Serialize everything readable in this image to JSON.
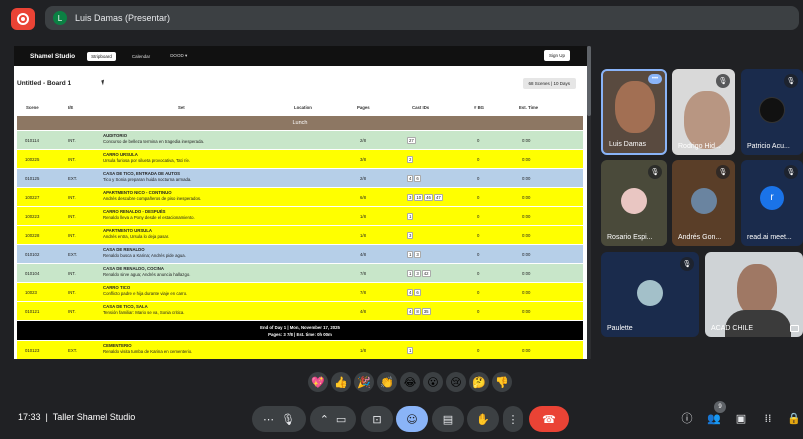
{
  "presenter": {
    "avatar_letter": "L",
    "label": "Luis Damas (Presentar)"
  },
  "app": {
    "brand": "Shamel Studio",
    "nav": [
      "Stripboard",
      "Calendar",
      "DOOD"
    ],
    "signup": "Sign Up",
    "board_title": "Untitled - Board 1",
    "scenes_badge": "68 Scenes | 10 Days",
    "columns": [
      "Scene",
      "I/E",
      "Set",
      "Location",
      "Pages",
      "Cast IDs",
      "# BG",
      "Est. Time"
    ],
    "lunch_label": "Lunch",
    "rows": [
      {
        "scene": "010114",
        "ie": "INT.",
        "set": "AUDITORIO",
        "desc": "Concurso de belleza termina en tragedia inesperada.",
        "pages": "2/8",
        "cast": [
          "27"
        ],
        "bg": "0",
        "time": "0:00",
        "color": "green"
      },
      {
        "scene": "100225",
        "ie": "INT.",
        "set": "CARRO URSULA",
        "desc": "Ursula furiosa por silueta provocativa, Tati ríe.",
        "pages": "3/8",
        "cast": [
          "2"
        ],
        "bg": "0",
        "time": "0:00",
        "color": "yellow"
      },
      {
        "scene": "010125",
        "ie": "EXT.",
        "set": "CASA DE TICO, ENTRADA DE AUTOS",
        "desc": "Tico y Sonia preparan huida nocturna armada.",
        "pages": "2/8",
        "cast": [
          "4",
          "6"
        ],
        "bg": "0",
        "time": "0:00",
        "color": "blue"
      },
      {
        "scene": "100227",
        "ie": "INT.",
        "set": "APARTMENTO NICO - CONTINUO",
        "desc": "Andrés descubre compañeros de piso inesperados.",
        "pages": "6/8",
        "cast": [
          "3",
          "10",
          "46",
          "47"
        ],
        "bg": "0",
        "time": "0:00",
        "color": "yellow"
      },
      {
        "scene": "100223",
        "ie": "INT.",
        "set": "CARRO RENALDO - DESPUÉS",
        "desc": "Renaldo lleva a Pony desde el estacionamiento.",
        "pages": "1/8",
        "cast": [
          "1"
        ],
        "bg": "0",
        "time": "0:00",
        "color": "yellow"
      },
      {
        "scene": "100228",
        "ie": "INT.",
        "set": "APARTMENTO URSULA",
        "desc": "Andrés entra, Ursula lo deja pasar.",
        "pages": "1/8",
        "cast": [
          "3"
        ],
        "bg": "0",
        "time": "0:00",
        "color": "yellow"
      },
      {
        "scene": "010102",
        "ie": "EXT.",
        "set": "CASA DE RENALDO",
        "desc": "Renaldo busca a Karina; Andrés pide agua.",
        "pages": "4/8",
        "cast": [
          "1",
          "3"
        ],
        "bg": "0",
        "time": "0:00",
        "color": "blue"
      },
      {
        "scene": "010104",
        "ie": "INT.",
        "set": "CASA DE RENALDO, COCINA",
        "desc": "Renaldo sirve agua; Andrés anuncia hallazgo.",
        "pages": "7/8",
        "cast": [
          "1",
          "3",
          "42"
        ],
        "bg": "0",
        "time": "0:00",
        "color": "green"
      },
      {
        "scene": "10023",
        "ie": "INT.",
        "set": "CARRO TICO",
        "desc": "Conflicto padre e hija durante viaje en carro.",
        "pages": "7/8",
        "cast": [
          "4",
          "6"
        ],
        "bg": "0",
        "time": "0:00",
        "color": "yellow"
      },
      {
        "scene": "010121",
        "ie": "INT.",
        "set": "CASA DE TICO, SALA",
        "desc": "Tensión familiar: Mario se va, Sonia critica.",
        "pages": "4/8",
        "cast": [
          "4",
          "8",
          "35"
        ],
        "bg": "0",
        "time": "0:00",
        "color": "yellow"
      }
    ],
    "eod_line1": "End of Day 1 | Mon, November 17, 2025",
    "eod_line2": "Pages: 3 7/8 | Est. time: 0h 00m",
    "last_row": {
      "scene": "010123",
      "ie": "EXT.",
      "set": "CEMENTERIO",
      "desc": "Renaldo visita tumba de Karina en cementerio.",
      "pages": "1/8",
      "cast": [
        "1"
      ],
      "bg": "0",
      "time": "0:00",
      "color": "yellow"
    }
  },
  "participants": [
    {
      "name": "Luis Damas"
    },
    {
      "name": "Rodrigo Hid..."
    },
    {
      "name": "Patricio Acu..."
    },
    {
      "name": "Rosario Espi..."
    },
    {
      "name": "Andrés Gon..."
    },
    {
      "name": "read.ai meet...",
      "letter": "r"
    },
    {
      "name": "Paulette"
    },
    {
      "name": "ACAD CHILE"
    }
  ],
  "reactions": [
    "💖",
    "👍",
    "🎉",
    "👏",
    "😂",
    "😮",
    "😢",
    "🤔",
    "👎"
  ],
  "bottom": {
    "clock": "17:33",
    "meeting": "Taller Shamel Studio",
    "people_count": "9"
  },
  "colors": {
    "accent": "#8ab4f8",
    "hangup": "#ea4335",
    "bg": "#202124",
    "lunch": "#8d7763",
    "yellow": "#ffff00",
    "green": "#c8e6c9",
    "blue": "#b6cfe8"
  },
  "icons": [
    "record-icon",
    "mic-icon",
    "camera-icon",
    "present-icon",
    "emoji-icon",
    "captions-icon",
    "raise-hand-icon",
    "more-icon",
    "hangup-icon",
    "info-icon",
    "people-icon",
    "chat-icon",
    "activities-icon",
    "lock-icon"
  ]
}
